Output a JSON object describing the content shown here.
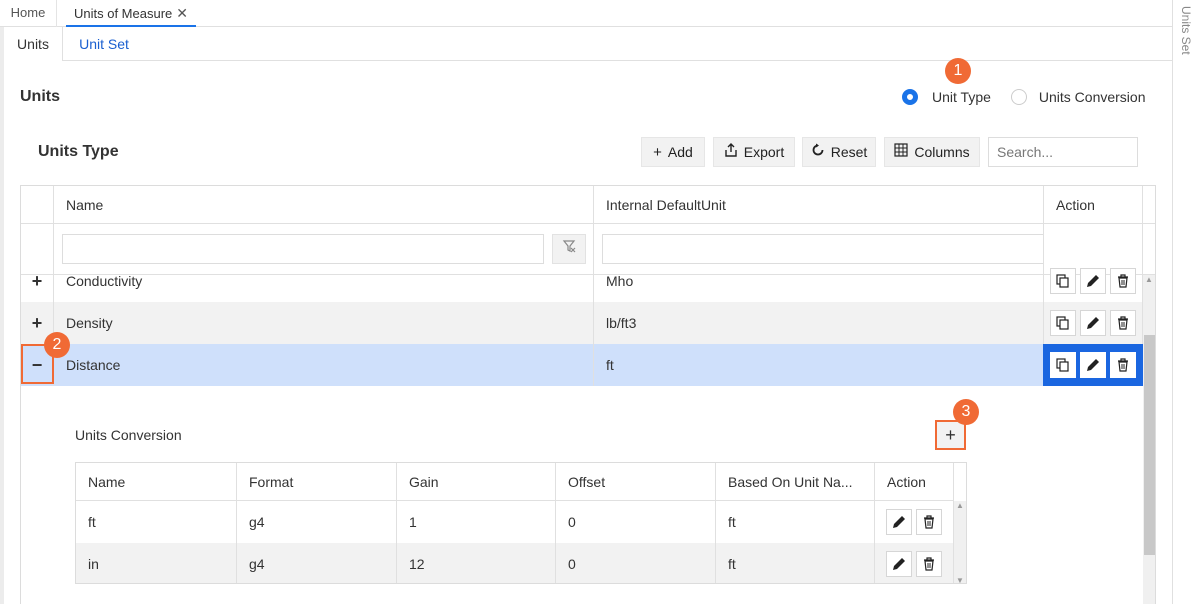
{
  "tabs": [
    {
      "label": "Home"
    },
    {
      "label": "Units of Measure",
      "close": "✕"
    }
  ],
  "subtabs": [
    {
      "label": "Units"
    },
    {
      "label": "Unit Set"
    }
  ],
  "right_panel": {
    "label": "Units Set"
  },
  "page": {
    "title": "Units",
    "radio": [
      {
        "label": "Unit Type",
        "checked": true
      },
      {
        "label": "Units Conversion",
        "checked": false
      }
    ]
  },
  "badges": [
    "1",
    "2",
    "3"
  ],
  "section": {
    "title": "Units Type"
  },
  "toolbar": {
    "add": {
      "icon": "plus-icon",
      "label": "Add"
    },
    "export": {
      "icon": "export-icon",
      "label": "Export"
    },
    "reset": {
      "icon": "reset-icon",
      "label": "Reset"
    },
    "columns": {
      "icon": "columns-icon",
      "label": "Columns"
    },
    "search_placeholder": "Search..."
  },
  "grid": {
    "columns": [
      "Name",
      "Internal DefaultUnit",
      "Action"
    ],
    "rows": [
      {
        "expander": "+",
        "name": "Conductivity",
        "default_unit": "Mho"
      },
      {
        "expander": "+",
        "name": "Density",
        "default_unit": "lb/ft3"
      },
      {
        "expander": "−",
        "name": "Distance",
        "default_unit": "ft",
        "selected": true
      }
    ]
  },
  "detail": {
    "title": "Units Conversion",
    "add_label": "+",
    "columns": [
      "Name",
      "Format",
      "Gain",
      "Offset",
      "Based On Unit Na...",
      "Action"
    ],
    "rows": [
      {
        "name": "ft",
        "format": "g4",
        "gain": "1",
        "offset": "0",
        "based_on": "ft"
      },
      {
        "name": "in",
        "format": "g4",
        "gain": "12",
        "offset": "0",
        "based_on": "ft"
      }
    ]
  },
  "colors": {
    "accent": "#1a73e8",
    "badge": "#f06a35",
    "selected_row": "#cfe0fb"
  }
}
